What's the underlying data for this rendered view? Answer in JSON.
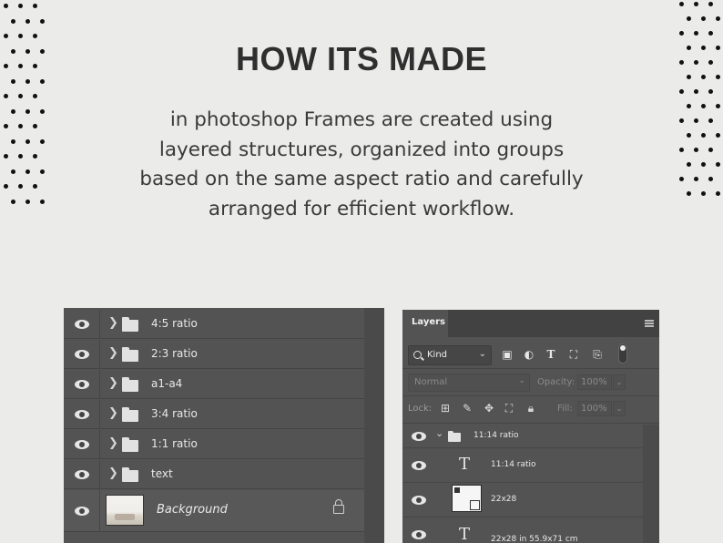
{
  "header": {
    "title": "HOW ITS MADE",
    "subtitle_lines": [
      "in photoshop Frames are created using",
      "layered structures, organized into groups",
      "based on the same aspect ratio and carefully",
      "arranged for efficient workflow."
    ]
  },
  "left_layers": {
    "groups": [
      {
        "label": "4:5 ratio",
        "icon": "folder-icon"
      },
      {
        "label": "2:3 ratio",
        "icon": "folder-icon"
      },
      {
        "label": "a1-a4",
        "icon": "folder-icon"
      },
      {
        "label": "3:4 ratio",
        "icon": "folder-icon"
      },
      {
        "label": "1:1 ratio",
        "icon": "folder-icon"
      },
      {
        "label": "text",
        "icon": "folder-icon"
      }
    ],
    "background": {
      "label": "Background",
      "icon": "lock-icon"
    }
  },
  "layers_panel": {
    "tab_label": "Layers",
    "filter_label": "Kind",
    "blend_mode": "Normal",
    "opacity_label": "Opacity:",
    "opacity_value": "100%",
    "lock_label": "Lock:",
    "fill_label": "Fill:",
    "fill_value": "100%",
    "rows": [
      {
        "type": "group",
        "label": "11:14 ratio"
      },
      {
        "type": "text",
        "label": "11:14 ratio"
      },
      {
        "type": "smart-object",
        "label": "22x28"
      },
      {
        "type": "text",
        "label": "22x28 in 55.9x71 cm"
      }
    ]
  },
  "colors": {
    "page_background": "#ebebea",
    "panel_background": "#535353",
    "tab_bar": "#424242",
    "text_light": "#e8e8e8"
  }
}
